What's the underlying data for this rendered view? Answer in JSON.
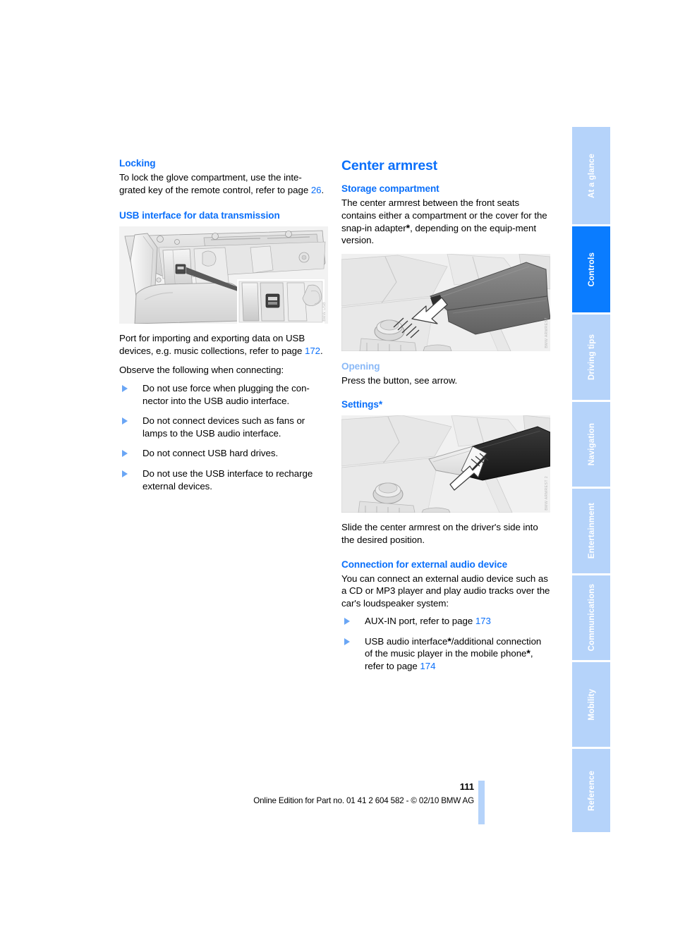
{
  "document": {
    "page_number": "111",
    "footer_note": "Online Edition for Part no. 01 41 2 604 582 - © 02/10 BMW AG"
  },
  "colors": {
    "heading_blue": "#0a6ffa",
    "subheading_light_blue": "#8ab9f7",
    "tab_inactive": "#b5d3fa",
    "tab_active": "#0a7cff",
    "bullet_marker": "#6aa6f5",
    "figure_background": "#f2f2f2"
  },
  "left_column": {
    "locking": {
      "heading": "Locking",
      "paragraph_a": "To lock the glove compartment, use the inte-grated key of the remote control, refer to page ",
      "page_ref": "26",
      "paragraph_b": "."
    },
    "usb": {
      "heading": "USB interface for data transmission",
      "figure_name": "glove-compartment-usb-port-illustration",
      "figure_watermark": "BMW USB",
      "paragraph_a": "Port for importing and exporting data on USB devices, e.g. music collections, refer to page ",
      "page_ref": "172",
      "paragraph_b": ".",
      "observe_intro": "Observe the following when connecting:",
      "bullets": [
        "Do not use force when plugging the con-nector into the USB audio interface.",
        "Do not connect devices such as fans or lamps to the USB audio interface.",
        "Do not connect USB hard drives.",
        "Do not use the USB interface to recharge external devices."
      ]
    }
  },
  "right_column": {
    "title": "Center armrest",
    "storage": {
      "heading": "Storage compartment",
      "paragraph_start": "The center armrest between the front seats contains either a compartment or the cover for the snap-in adapter",
      "asterisk": "*",
      "paragraph_end": ", depending on the equip-ment version.",
      "figure_name": "center-armrest-closed-illustration",
      "figure_watermark": "BMW ARMREST"
    },
    "opening": {
      "heading": "Opening",
      "paragraph": "Press the button, see arrow."
    },
    "settings": {
      "heading": "Settings*",
      "figure_name": "center-armrest-slide-illustration",
      "figure_watermark": "BMW ARMREST 2",
      "paragraph": "Slide the center armrest on the driver's side into the desired position."
    },
    "connection": {
      "heading": "Connection for external audio device",
      "paragraph": "You can connect an external audio device such as a CD or MP3 player and play audio tracks over the car's loudspeaker system:",
      "bullets": [
        {
          "text_before": "AUX-IN port, refer to page ",
          "page_ref": "173",
          "text_after": ""
        },
        {
          "text_before": "USB audio interface",
          "asterisk1": "*",
          "text_mid": "/additional connection of the music player in the mobile phone",
          "asterisk2": "*",
          "text_after2": ", refer to page ",
          "page_ref": "174",
          "text_after": ""
        }
      ]
    }
  },
  "sidebar": {
    "tabs": [
      {
        "label": "At a glance",
        "active": false
      },
      {
        "label": "Controls",
        "active": true
      },
      {
        "label": "Driving tips",
        "active": false
      },
      {
        "label": "Navigation",
        "active": false
      },
      {
        "label": "Entertainment",
        "active": false
      },
      {
        "label": "Communications",
        "active": false
      },
      {
        "label": "Mobility",
        "active": false
      },
      {
        "label": "Reference",
        "active": false
      }
    ]
  }
}
